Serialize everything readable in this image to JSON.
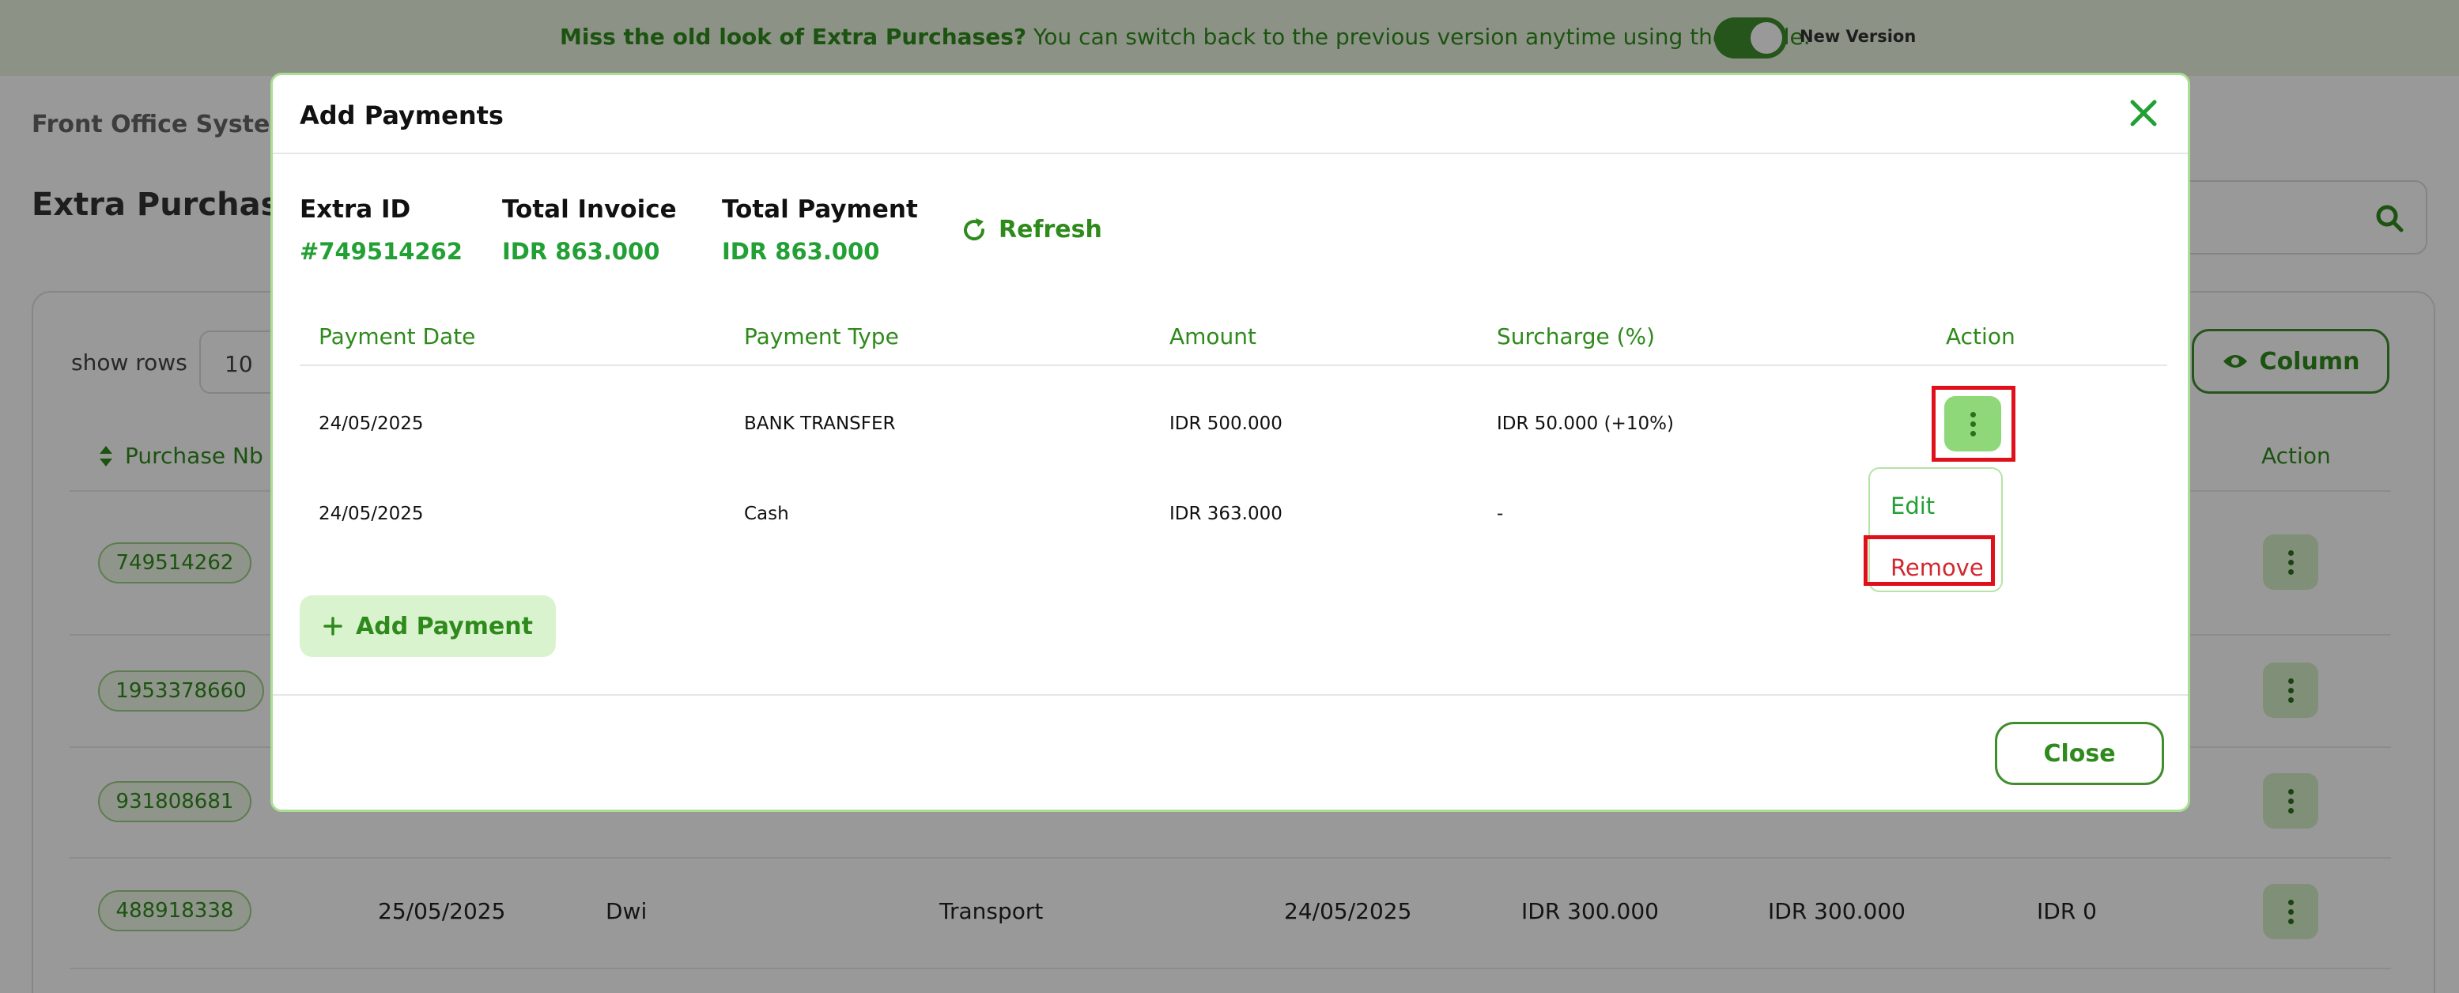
{
  "banner": {
    "bold_text": "Miss the old look of Extra Purchases?",
    "text": "You can switch back to the previous version anytime using the toggle.",
    "toggle_label": "New Version"
  },
  "background": {
    "breadcrumb": "Front Office Syster",
    "title": "Extra Purchases",
    "show_rows_label": "show rows",
    "rows_value": "10",
    "column_button": "Column",
    "header_purchase": "Purchase Nb",
    "header_action": "Action",
    "rows": [
      {
        "id": "749514262"
      },
      {
        "id": "1953378660"
      },
      {
        "id": "931808681"
      },
      {
        "id": "488918338",
        "date": "25/05/2025",
        "name": "Dwi",
        "category": "Transport",
        "date2": "24/05/2025",
        "amount1": "IDR 300.000",
        "amount2": "IDR 300.000",
        "amount3": "IDR 0"
      }
    ]
  },
  "modal": {
    "title": "Add Payments",
    "summary": {
      "extra_id_label": "Extra ID",
      "extra_id_value": "#749514262",
      "total_invoice_label": "Total Invoice",
      "total_invoice_value": "IDR 863.000",
      "total_payment_label": "Total Payment",
      "total_payment_value": "IDR 863.000",
      "refresh_label": "Refresh"
    },
    "columns": [
      "Payment Date",
      "Payment Type",
      "Amount",
      "Surcharge (%)",
      "Action"
    ],
    "rows": [
      {
        "date": "24/05/2025",
        "type": "BANK TRANSFER",
        "amount": "IDR 500.000",
        "surcharge": "IDR 50.000 (+10%)"
      },
      {
        "date": "24/05/2025",
        "type": "Cash",
        "amount": "IDR 363.000",
        "surcharge": "-"
      }
    ],
    "menu": {
      "edit": "Edit",
      "remove": "Remove"
    },
    "add_payment_label": "Add Payment",
    "close_label": "Close"
  },
  "colors": {
    "accent": "#2f8a1c",
    "accent_bright": "#23a035",
    "danger": "#d2272f",
    "highlight": "#e0101a"
  }
}
